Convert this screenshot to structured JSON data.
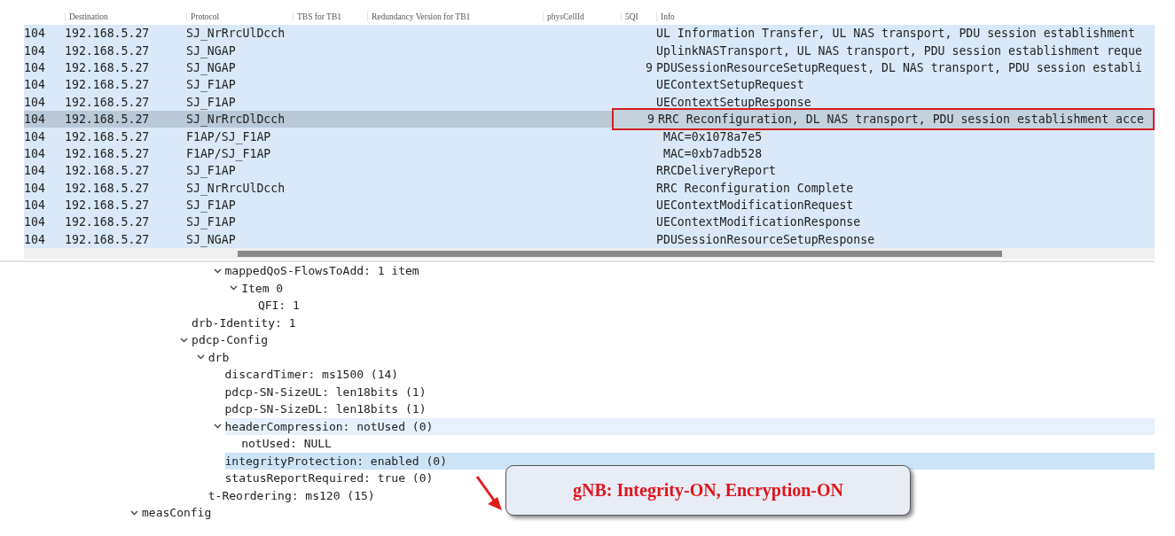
{
  "packet_list": {
    "columns": [
      "Destination",
      "Protocol",
      "TBS for TB1",
      "Redundancy Version for TB1",
      "physCellId",
      "5QI",
      "Info"
    ],
    "rows": [
      {
        "column_1": "104",
        "destination": "192.168.5.27",
        "protocol": "SJ_NrRrcUlDcch",
        "info": "UL Information Transfer, UL NAS transport, PDU session establishment",
        "selected": false,
        "boxed": false
      },
      {
        "column_1": "104",
        "destination": "192.168.5.27",
        "protocol": "SJ_NGAP",
        "info": "UplinkNASTransport, UL NAS transport, PDU session establishment reque",
        "selected": false,
        "boxed": false
      },
      {
        "column_1": "104",
        "destination": "192.168.5.27",
        "protocol": "SJ_NGAP",
        "qi": "9",
        "info": "PDUSessionResourceSetupRequest, DL NAS transport, PDU session establi",
        "selected": false,
        "boxed": false
      },
      {
        "column_1": "104",
        "destination": "192.168.5.27",
        "protocol": "SJ_F1AP",
        "info": "UEContextSetupRequest",
        "selected": false,
        "boxed": false
      },
      {
        "column_1": "104",
        "destination": "192.168.5.27",
        "protocol": "SJ_F1AP",
        "info": "UEContextSetupResponse",
        "selected": false,
        "boxed": false
      },
      {
        "column_1": "104",
        "destination": "192.168.5.27",
        "protocol": "SJ_NrRrcDlDcch",
        "qi": "9",
        "info": "RRC Reconfiguration, DL NAS transport, PDU session establishment acce",
        "selected": true,
        "boxed": true
      },
      {
        "column_1": "104",
        "destination": "192.168.5.27",
        "protocol": "F1AP/SJ_F1AP",
        "info": " MAC=0x1078a7e5",
        "selected": false,
        "boxed": false
      },
      {
        "column_1": "104",
        "destination": "192.168.5.27",
        "protocol": "F1AP/SJ_F1AP",
        "info": " MAC=0xb7adb528",
        "selected": false,
        "boxed": false
      },
      {
        "column_1": "104",
        "destination": "192.168.5.27",
        "protocol": "SJ_F1AP",
        "info": "RRCDeliveryReport",
        "selected": false,
        "boxed": false
      },
      {
        "column_1": "104",
        "destination": "192.168.5.27",
        "protocol": "SJ_NrRrcUlDcch",
        "info": "RRC Reconfiguration Complete",
        "selected": false,
        "boxed": false
      },
      {
        "column_1": "104",
        "destination": "192.168.5.27",
        "protocol": "SJ_F1AP",
        "info": "UEContextModificationRequest",
        "selected": false,
        "boxed": false
      },
      {
        "column_1": "104",
        "destination": "192.168.5.27",
        "protocol": "SJ_F1AP",
        "info": "UEContextModificationResponse",
        "selected": false,
        "boxed": false
      },
      {
        "column_1": "104",
        "destination": "192.168.5.27",
        "protocol": "SJ_NGAP",
        "info": "PDUSessionResourceSetupResponse",
        "selected": false,
        "boxed": false
      }
    ]
  },
  "details": {
    "children": [
      {
        "children": [
          {
            "children": [
              {
                "children": [
                  {
                    "children": [
                      {
                        "children": [
                          {
                            "label": "mappedQoS-FlowsToAdd: 1 item",
                            "expanded": true,
                            "selected": false,
                            "related": false,
                            "children": [
                              {
                                "label": "Item 0",
                                "expanded": true,
                                "selected": false,
                                "related": false,
                                "children": [
                                  {
                                    "label": "QFI: 1",
                                    "selected": false,
                                    "related": false
                                  }
                                ]
                              }
                            ]
                          }
                        ]
                      }
                    ]
                  },
                  {
                    "label": "drb-Identity: 1",
                    "selected": false,
                    "related": false
                  },
                  {
                    "label": "pdcp-Config",
                    "expanded": true,
                    "selected": false,
                    "related": false,
                    "children": [
                      {
                        "label": "drb",
                        "expanded": true,
                        "selected": false,
                        "related": false,
                        "children": [
                          {
                            "label": "discardTimer: ms1500 (14)",
                            "selected": false,
                            "related": false
                          },
                          {
                            "label": "pdcp-SN-SizeUL: len18bits (1)",
                            "selected": false,
                            "related": false
                          },
                          {
                            "label": "pdcp-SN-SizeDL: len18bits (1)",
                            "selected": false,
                            "related": false
                          },
                          {
                            "label": "headerCompression: notUsed (0)",
                            "expanded": true,
                            "selected": false,
                            "related": true,
                            "children": [
                              {
                                "label": "notUsed: NULL",
                                "selected": false,
                                "related": false
                              }
                            ]
                          },
                          {
                            "label": "integrityProtection: enabled (0)",
                            "selected": true,
                            "related": false
                          },
                          {
                            "label": "statusReportRequired: true (0)",
                            "selected": false,
                            "related": false
                          }
                        ]
                      },
                      {
                        "label": "t-Reordering: ms120 (15)",
                        "selected": false,
                        "related": false
                      }
                    ]
                  }
                ]
              }
            ]
          }
        ]
      },
      {
        "label": "measConfig",
        "expanded": true,
        "selected": false,
        "related": false
      }
    ]
  },
  "callout": {
    "text": "gNB: Integrity-ON, Encryption-ON"
  }
}
